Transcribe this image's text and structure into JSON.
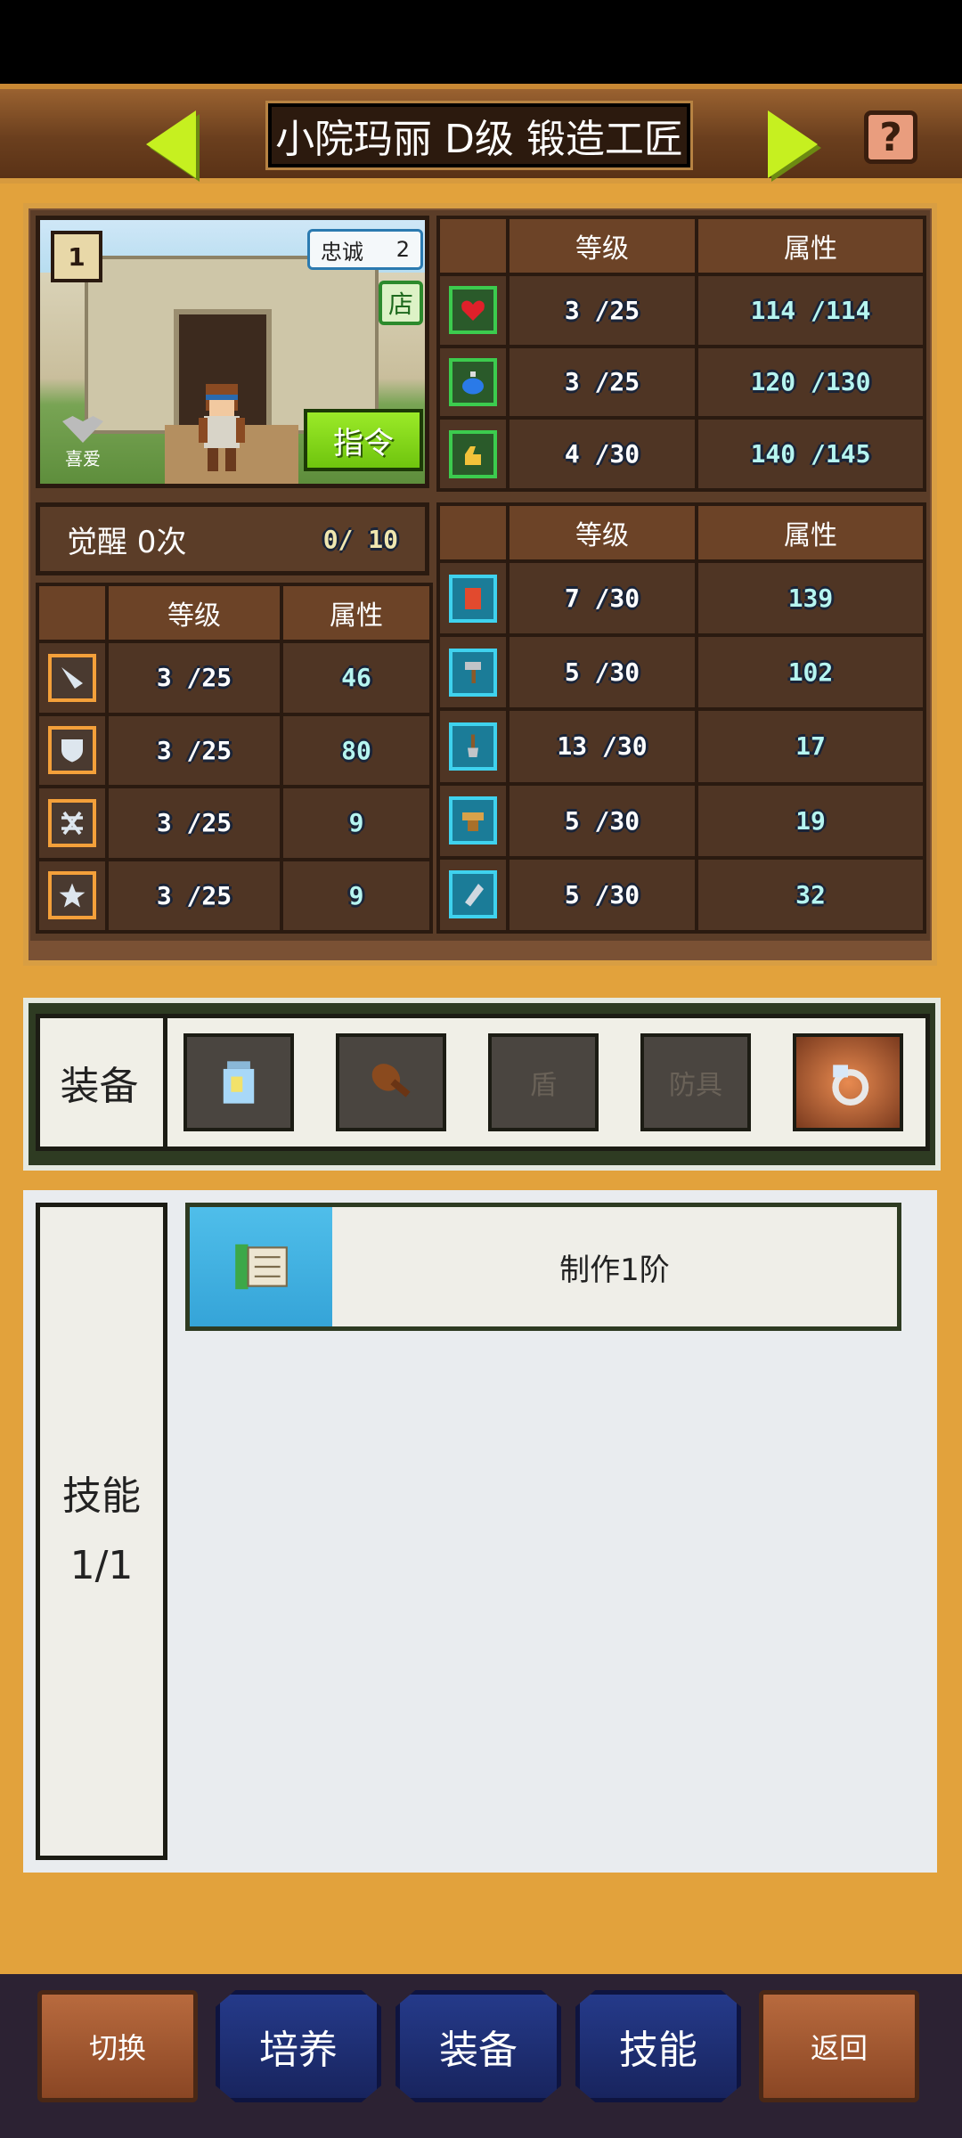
{
  "header": {
    "title": "小院玛丽 D级 锻造工匠",
    "help_icon": "question-mark-icon",
    "help_text": "?"
  },
  "portrait": {
    "level_badge": "1",
    "loyalty_label": "忠诚",
    "loyalty_value": "2",
    "shop_badge": "店",
    "command_label": "指令",
    "like_label": "喜爱"
  },
  "top_stats": {
    "headers": [
      "等级",
      "属性"
    ],
    "rows": [
      {
        "icon": "heart-icon",
        "level": "3 /25",
        "value": "114 /114"
      },
      {
        "icon": "potion-icon",
        "level": "3 /25",
        "value": "120 /130"
      },
      {
        "icon": "strength-icon",
        "level": "4 /30",
        "value": "140 /145"
      }
    ]
  },
  "awaken": {
    "label": "觉醒 0次",
    "progress": "0/ 10"
  },
  "combat_stats": {
    "headers": [
      "等级",
      "属性"
    ],
    "rows": [
      {
        "icon": "sword-icon",
        "level": "3 /25",
        "value": "46"
      },
      {
        "icon": "shield-icon",
        "level": "3 /25",
        "value": "80"
      },
      {
        "icon": "crossed-arrows-icon",
        "level": "3 /25",
        "value": "9"
      },
      {
        "icon": "star-icon",
        "level": "3 /25",
        "value": "9"
      }
    ]
  },
  "craft_stats": {
    "headers": [
      "等级",
      "属性"
    ],
    "rows": [
      {
        "icon": "book-icon",
        "level": "7 /30",
        "value": "139"
      },
      {
        "icon": "hammer-icon",
        "level": "5 /30",
        "value": "102"
      },
      {
        "icon": "shovel-icon",
        "level": "13 /30",
        "value": "17"
      },
      {
        "icon": "anvil-icon",
        "level": "5 /30",
        "value": "19"
      },
      {
        "icon": "whetstone-icon",
        "level": "5 /30",
        "value": "32"
      }
    ]
  },
  "equipment": {
    "label": "装备",
    "slots": [
      {
        "icon": "jar-icon",
        "text": ""
      },
      {
        "icon": "club-icon",
        "text": ""
      },
      {
        "icon": "",
        "text": "盾"
      },
      {
        "icon": "",
        "text": "防具"
      },
      {
        "icon": "ring-icon",
        "text": ""
      }
    ]
  },
  "skills": {
    "label": "技能",
    "count": "1/1",
    "items": [
      {
        "icon": "scroll-icon",
        "name": "制作1阶"
      }
    ]
  },
  "footer": {
    "buttons": [
      "切换",
      "培养",
      "装备",
      "技能",
      "返回"
    ]
  },
  "colors": {
    "accent_green": "#C6F020",
    "panel_brown": "#5B3D28",
    "background": "#E2A23C"
  }
}
